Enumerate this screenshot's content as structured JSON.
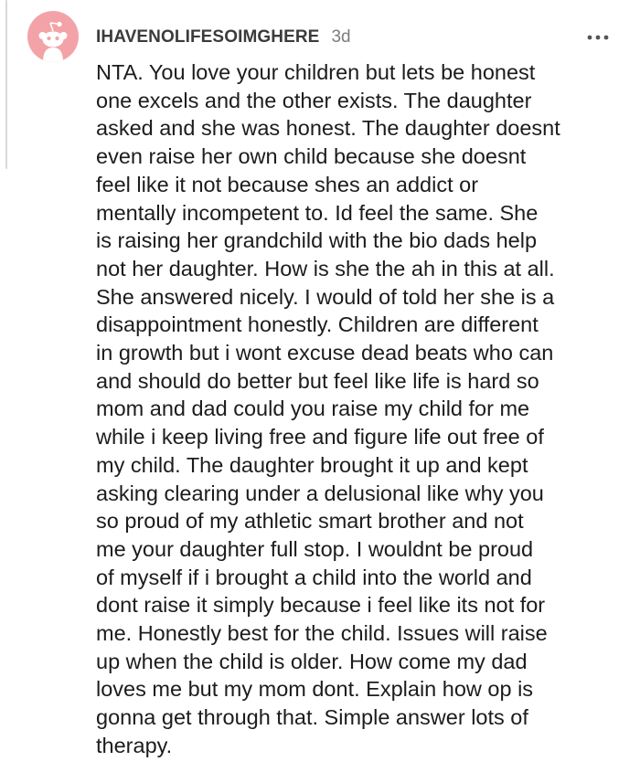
{
  "comment": {
    "avatar": "reddit-snoo-avatar",
    "username": "IHAVENOLIFESOIMGHERE",
    "timestamp": "3d",
    "more_icon": "more-dots-icon",
    "lines": [
      "NTA. You love your children but lets be honest",
      "one excels and the other exists. The daughter",
      "asked and she was honest. The daughter doesnt",
      "even raise her own child because she doesnt",
      "feel like it not because shes an addict or",
      "mentally incompetent to. Id feel the same. She",
      "is raising her grandchild with the bio dads help",
      "not her daughter. How is she the ah in this at all.",
      "She answered nicely. I would of told her she is a",
      "disappointment honestly. Children are different",
      "in growth but i wont excuse dead beats who can",
      "and should do better but feel like life is hard so",
      "mom and dad could you raise my child for me",
      "while i keep living free and figure life out free of",
      "my child. The daughter brought it up and kept",
      "asking clearing under a delusional like why you",
      "so proud of my athletic smart brother and not",
      "me your daughter full stop. I wouldnt be proud",
      "of myself if i brought a child into the world and",
      "dont raise it simply because i feel like its not for",
      "me. Honestly best for the child. Issues will raise",
      "up when the child is older. How come my dad",
      "loves me but my mom dont. Explain how op is",
      "gonna get through that. Simple answer lots of",
      "therapy."
    ]
  },
  "colors": {
    "avatar_bg": "#f3a3a8",
    "username": "#3b3b3c",
    "timestamp": "#7c7c7c",
    "text": "#1c1c1c",
    "thread_line": "#d7d9db"
  }
}
